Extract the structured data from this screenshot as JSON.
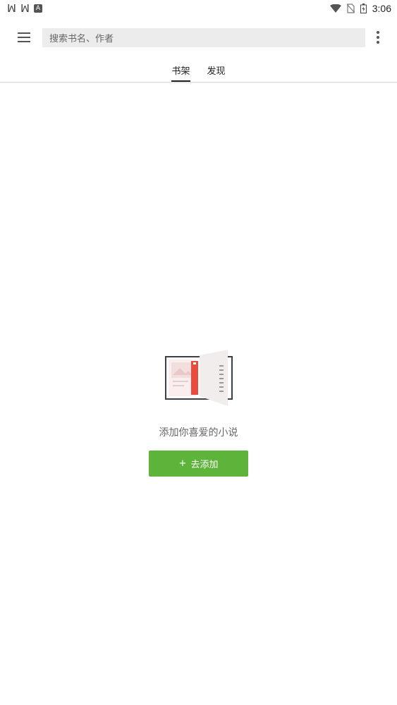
{
  "statusbar": {
    "left_icons": [
      "bug-icon",
      "bug-icon",
      "a-icon"
    ],
    "right_icons": [
      "wifi-icon",
      "no-sim-icon",
      "battery-icon"
    ],
    "time": "3:06"
  },
  "toolbar": {
    "menu_icon": "hamburger-icon",
    "search_placeholder": "搜索书名、作者",
    "more_icon": "more-vert-icon"
  },
  "tabs": [
    {
      "label": "书架",
      "active": true
    },
    {
      "label": "发现",
      "active": false
    }
  ],
  "empty_state": {
    "message": "添加你喜爱的小说",
    "button_icon": "plus-icon",
    "button_label": "去添加"
  },
  "colors": {
    "accent": "#5eb33b",
    "search_bg": "#ececec",
    "bookmark": "#e94b3c"
  }
}
